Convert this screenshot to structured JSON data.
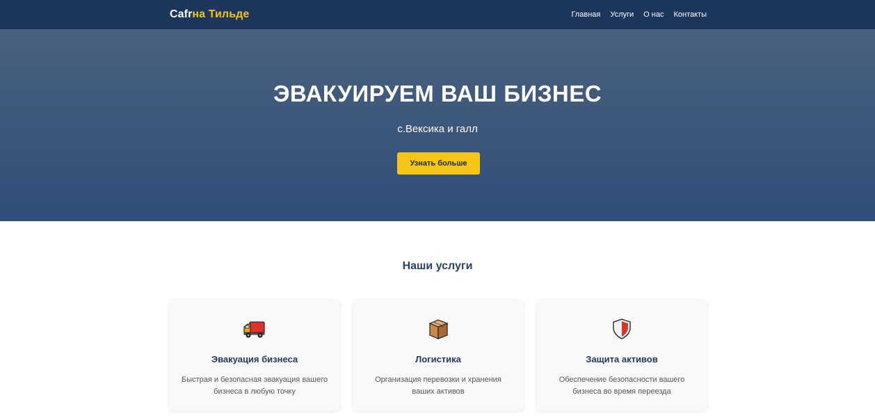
{
  "header": {
    "logo_part1": "Cafr",
    "logo_part2": "на Тильде",
    "nav": [
      "Главная",
      "Услуги",
      "О нас",
      "Контакты"
    ]
  },
  "hero": {
    "title": "ЭВАКУИРУЕМ ВАШ БИЗНЕС",
    "subtitle": "с.Вексика и галл",
    "cta_label": "Узнать больше"
  },
  "services": {
    "title": "Наши услуги",
    "cards": [
      {
        "icon": "truck-icon",
        "title": "Эвакуация бизнеса",
        "description": "Быстрая и безопасная эвакуация вашего бизнеса в любую точку"
      },
      {
        "icon": "box-icon",
        "title": "Логистика",
        "description": "Организация перевозки и хранения ваших активов"
      },
      {
        "icon": "shield-icon",
        "title": "Защита активов",
        "description": "Обеспечение безопасности вашего бизнеса во время переезда"
      }
    ]
  },
  "colors": {
    "header_bg": "#1c365c",
    "accent": "#f5c518",
    "hero_top": "#4a6180",
    "hero_bottom": "#2f4e77",
    "heading": "#2a4268"
  }
}
